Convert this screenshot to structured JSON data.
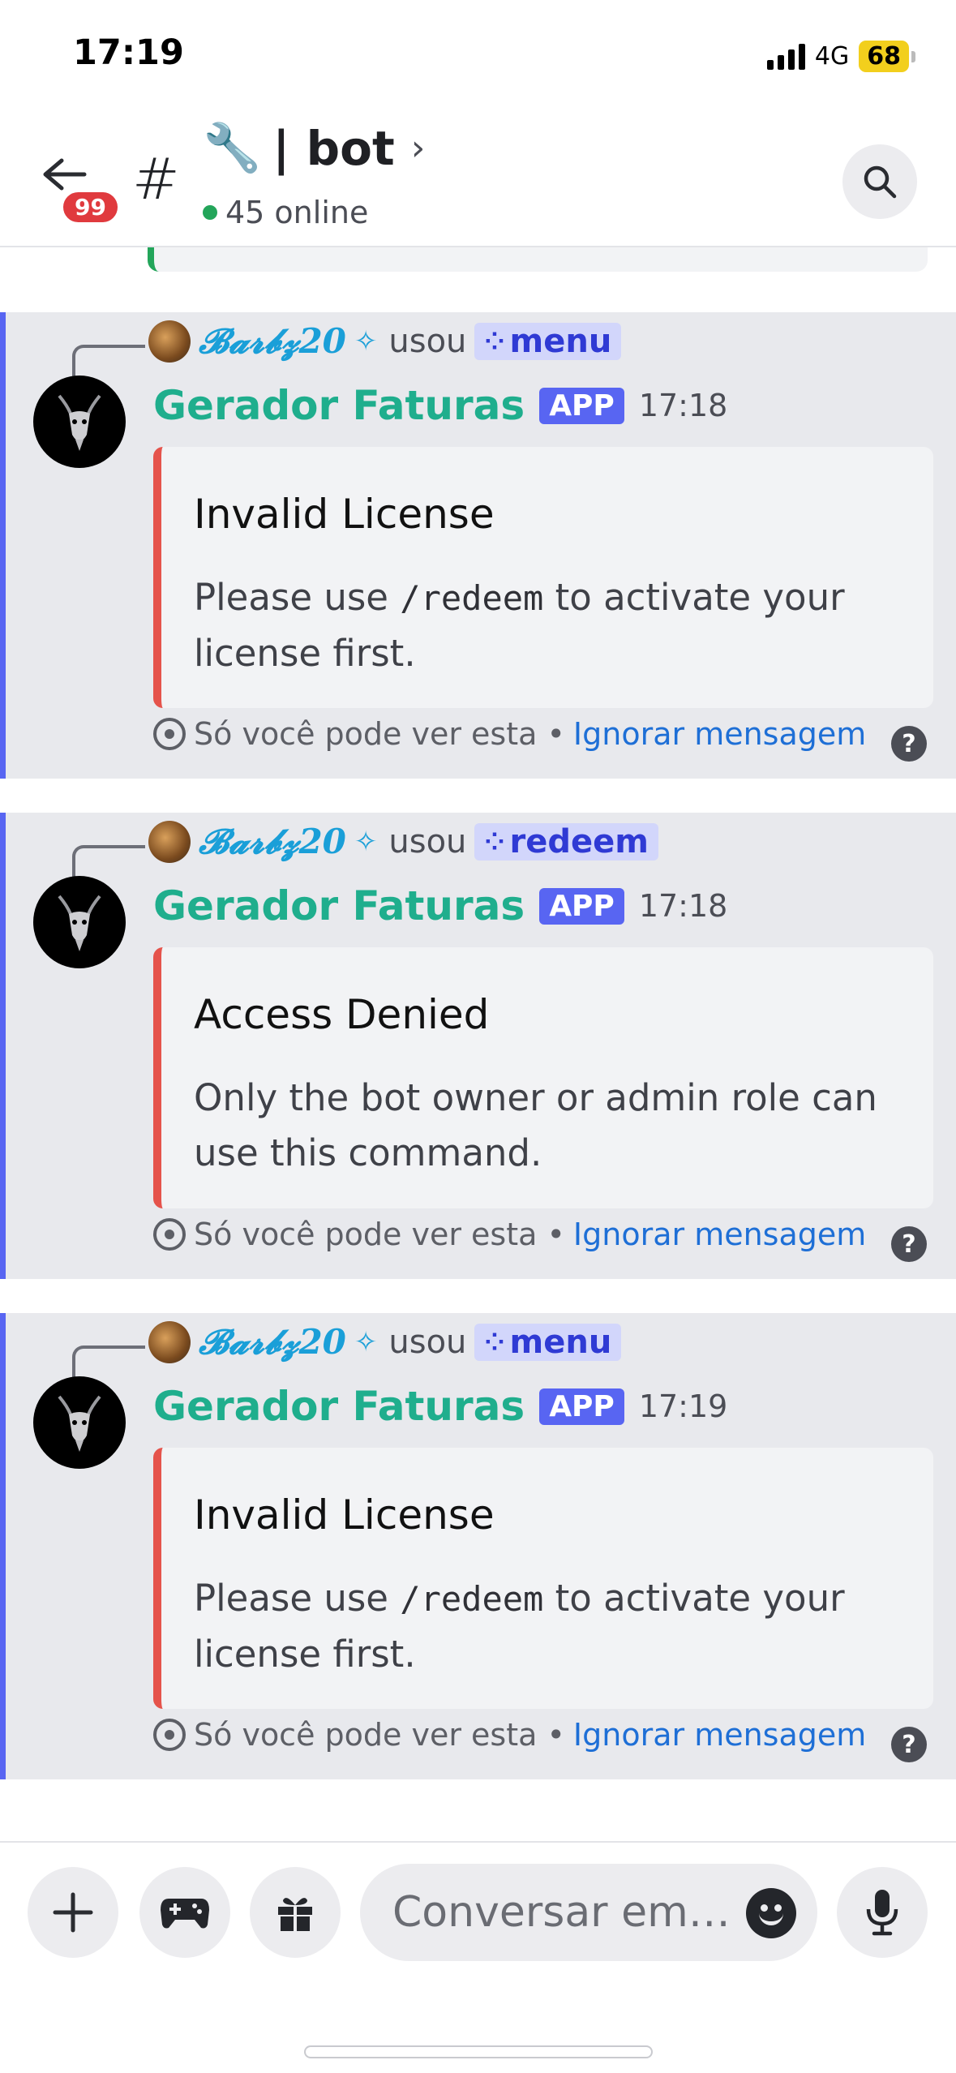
{
  "status_bar": {
    "time": "17:19",
    "network": "4G",
    "battery": "68"
  },
  "header": {
    "unread_badge": "99",
    "hash": "#",
    "channel_emoji": "🔧",
    "channel_name": "| bot",
    "chevron": "›",
    "online_count": "45 online"
  },
  "messages": [
    {
      "reply_user": "𝓑𝓪𝓻𝓫𝔃20",
      "reply_sparkle": "✧",
      "reply_verb": "usou",
      "command": "menu",
      "author": "Gerador Faturas",
      "app_tag": "APP",
      "time": "17:18",
      "embed_title": "Invalid License",
      "embed_desc_before": "Please use ",
      "embed_desc_code": "/redeem",
      "embed_desc_after": " to activate your license first.",
      "footer_text": "Só você pode ver esta •",
      "footer_link": "Ignorar mensagem"
    },
    {
      "reply_user": "𝓑𝓪𝓻𝓫𝔃20",
      "reply_sparkle": "✧",
      "reply_verb": "usou",
      "command": "redeem",
      "author": "Gerador Faturas",
      "app_tag": "APP",
      "time": "17:18",
      "embed_title": "Access Denied",
      "embed_desc": "Only the bot owner or admin role can use this command.",
      "footer_text": "Só você pode ver esta •",
      "footer_link": "Ignorar mensagem"
    },
    {
      "reply_user": "𝓑𝓪𝓻𝓫𝔃20",
      "reply_sparkle": "✧",
      "reply_verb": "usou",
      "command": "menu",
      "author": "Gerador Faturas",
      "app_tag": "APP",
      "time": "17:19",
      "embed_title": "Invalid License",
      "embed_desc_before": "Please use ",
      "embed_desc_code": "/redeem",
      "embed_desc_after": " to activate your license first.",
      "footer_text": "Só você pode ver esta •",
      "footer_link": "Ignorar mensagem"
    }
  ],
  "composer": {
    "placeholder": "Conversar em…"
  },
  "icons": {
    "back": "back-arrow-icon",
    "search": "search-icon",
    "add": "plus-icon",
    "games": "gamepad-icon",
    "gift": "gift-icon",
    "emoji": "emoji-icon",
    "mic": "microphone-icon"
  },
  "colors": {
    "accent": "#5865f2",
    "author": "#1fae8d",
    "embed_bar": "#e5534b",
    "link": "#1e6fd6",
    "online": "#23a55a"
  }
}
